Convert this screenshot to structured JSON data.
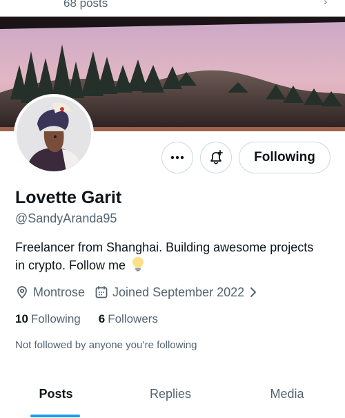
{
  "header": {
    "post_count": "68 posts"
  },
  "profile": {
    "display_name": "Lovette Garit",
    "handle": "@SandyAranda95",
    "bio": "Freelancer from Shanghai. Building awesome projects in crypto. Follow me",
    "location": "Montrose",
    "joined": "Joined September 2022",
    "following_count": "10",
    "following_label": "Following",
    "followers_count": "6",
    "followers_label": "Followers",
    "not_followed_text": "Not followed by anyone you’re following"
  },
  "actions": {
    "more_label": "•••",
    "follow_state_label": "Following"
  },
  "tabs": [
    {
      "label": "Posts",
      "active": true
    },
    {
      "label": "Replies",
      "active": false
    },
    {
      "label": "Media",
      "active": false
    }
  ],
  "colors": {
    "accent": "#1d9bf0",
    "text_primary": "#0f1419",
    "text_secondary": "#536471",
    "border": "#cfd9de"
  },
  "icons": {
    "location": "location-pin-icon",
    "calendar": "calendar-icon",
    "bulb": "lightbulb-emoji-icon",
    "notify": "notification-bell-plus-icon",
    "more": "more-dots-icon"
  }
}
